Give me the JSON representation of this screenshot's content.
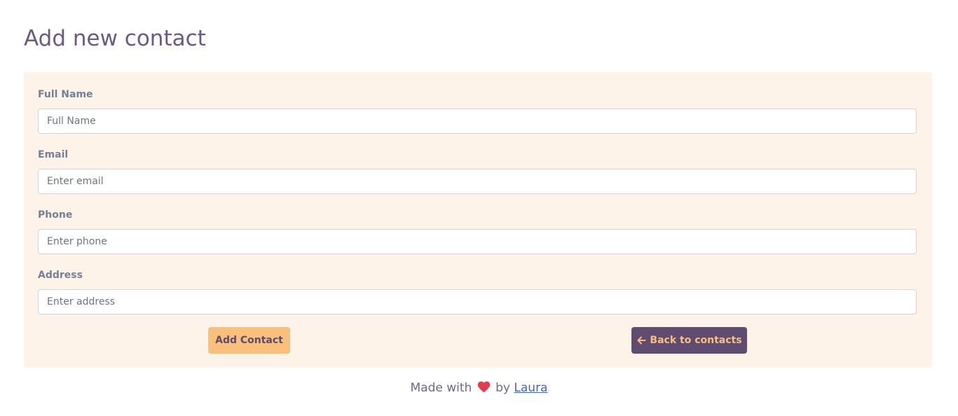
{
  "page": {
    "title": "Add new contact"
  },
  "form": {
    "fields": [
      {
        "label": "Full Name",
        "placeholder": "Full Name",
        "value": ""
      },
      {
        "label": "Email",
        "placeholder": "Enter email",
        "value": ""
      },
      {
        "label": "Phone",
        "placeholder": "Enter phone",
        "value": ""
      },
      {
        "label": "Address",
        "placeholder": "Enter address",
        "value": ""
      }
    ],
    "add_button_label": "Add Contact",
    "back_button_label": "Back to contacts",
    "back_button_icon": "arrow-left-icon"
  },
  "footer": {
    "prefix": "Made with",
    "icon": "heart-icon",
    "middle": "by",
    "author_link": "Laura"
  },
  "colors": {
    "title": "#6b5a84",
    "card_background": "#fdf3e8",
    "add_button": "#f8c07b",
    "back_button": "#614c71",
    "heart": "#e03e4e",
    "link": "#4466cc"
  }
}
